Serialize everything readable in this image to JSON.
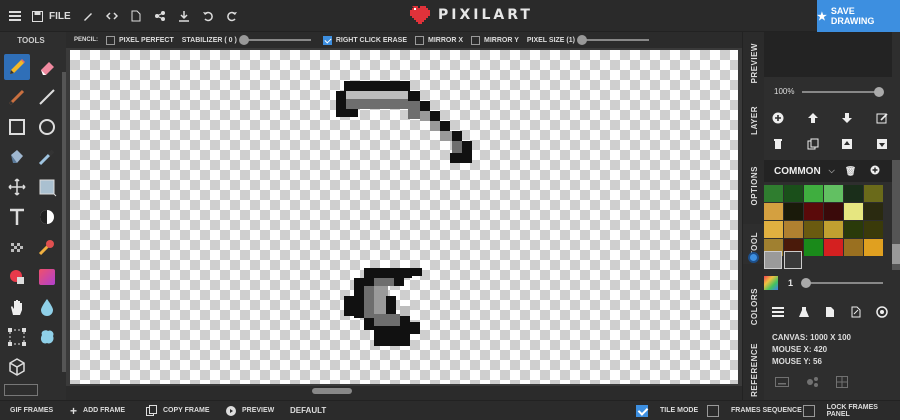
{
  "topbar": {
    "file_label": "FILE",
    "app_name": "PIXILART",
    "save_label": "SAVE DRAWING",
    "icons": [
      "menu-icon",
      "floppy-icon",
      "pencil-edit-icon",
      "code-icon",
      "document-icon",
      "share-icon",
      "download-icon",
      "undo-icon",
      "redo-icon"
    ]
  },
  "tools": {
    "title": "TOOLS",
    "items": [
      "pencil",
      "eraser",
      "line-brush",
      "line",
      "rectangle",
      "circle",
      "paint-bucket",
      "color-picker",
      "move",
      "select-fill",
      "text",
      "shade",
      "dither",
      "stamp",
      "gradient",
      "gradient-fill",
      "hand",
      "drop",
      "marquee",
      "blob",
      "cube"
    ],
    "active": "pencil"
  },
  "options": {
    "pencil_label": "PENCIL:",
    "pixel_perfect": {
      "label": "PIXEL PERFECT",
      "checked": false
    },
    "stabilizer": {
      "label": "STABILIZER ( 0 )",
      "value": 0
    },
    "right_click_erase": {
      "label": "RIGHT CLICK ERASE",
      "checked": true
    },
    "mirror_x": {
      "label": "MIRROR X",
      "checked": false
    },
    "mirror_y": {
      "label": "MIRROR Y",
      "checked": false
    },
    "pixel_size": {
      "label": "PIXEL SIZE (1)",
      "value": 1
    }
  },
  "side_tabs": {
    "preview": "PREVIEW",
    "layer": "LAYER",
    "options": "OPTIONS",
    "tool": "TOOL",
    "colors": "COLORS",
    "reference": "REFERENCE",
    "active": "TOOL"
  },
  "preview": {
    "zoom": "100%"
  },
  "palette": {
    "name": "COMMON",
    "swatches": [
      "#2f7d2f",
      "#1a4f1a",
      "#3fae3f",
      "#62c062",
      "#1a2e1a",
      "#6a6a1a",
      "#d4a040",
      "#1a1a0a",
      "#5a0a0a",
      "#3a0a0a",
      "#e6e680",
      "#2a2a10",
      "#e0b040",
      "#b08030",
      "#6a5a10",
      "#c0a030",
      "#2a3a0a",
      "#3a3a0a",
      "#a08030",
      "#4a1a0a",
      "#1a8a1a",
      "#d42020",
      "#9a7020",
      "#e0a020"
    ],
    "primary": "#9a9a9a",
    "secondary": "#3a3a3a"
  },
  "brush": {
    "size": "1"
  },
  "canvas_info": {
    "canvas": "CANVAS: 1000 X 100",
    "mouse_x": "MOUSE X: 420",
    "mouse_y": "MOUSE Y: 56"
  },
  "bottombar": {
    "gif_frames": "GIF FRAMES",
    "add_frame": "ADD FRAME",
    "copy_frame": "COPY FRAME",
    "preview": "PREVIEW",
    "speed": "DEFAULT",
    "tile_mode": {
      "label": "TILE MODE",
      "checked": true
    },
    "frames_sequence": {
      "label": "FRAMES SEQUENCE",
      "checked": false
    },
    "lock_frames_panel": {
      "label": "LOCK FRAMES PANEL",
      "checked": false
    }
  },
  "colors": {
    "accent": "#3d8fe0",
    "logo": "#e0323a"
  }
}
